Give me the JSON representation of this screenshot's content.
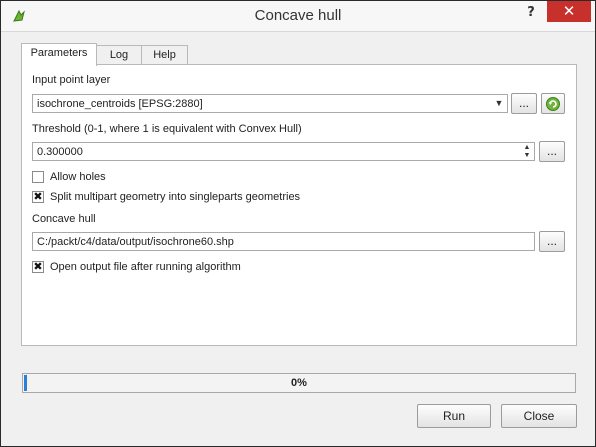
{
  "window": {
    "title": "Concave hull",
    "help_label": "?",
    "close_label": "✕"
  },
  "tabs": [
    {
      "label": "Parameters"
    },
    {
      "label": "Log"
    },
    {
      "label": "Help"
    }
  ],
  "params": {
    "input_layer_label": "Input point layer",
    "input_layer_value": "isochrone_centroids [EPSG:2880]",
    "threshold_label": "Threshold (0-1, where 1 is equivalent with Convex Hull)",
    "threshold_value": "0.300000",
    "allow_holes_label": "Allow holes",
    "allow_holes_checked": false,
    "split_label": "Split multipart geometry into singleparts geometries",
    "split_checked": true,
    "output_label": "Concave hull",
    "output_value": "C:/packt/c4/data/output/isochrone60.shp",
    "open_output_label": "Open output file after running algorithm",
    "open_output_checked": true,
    "browse_label": "..."
  },
  "progress": {
    "value": 0.0,
    "text": "0%"
  },
  "buttons": {
    "run": "Run",
    "close": "Close"
  }
}
